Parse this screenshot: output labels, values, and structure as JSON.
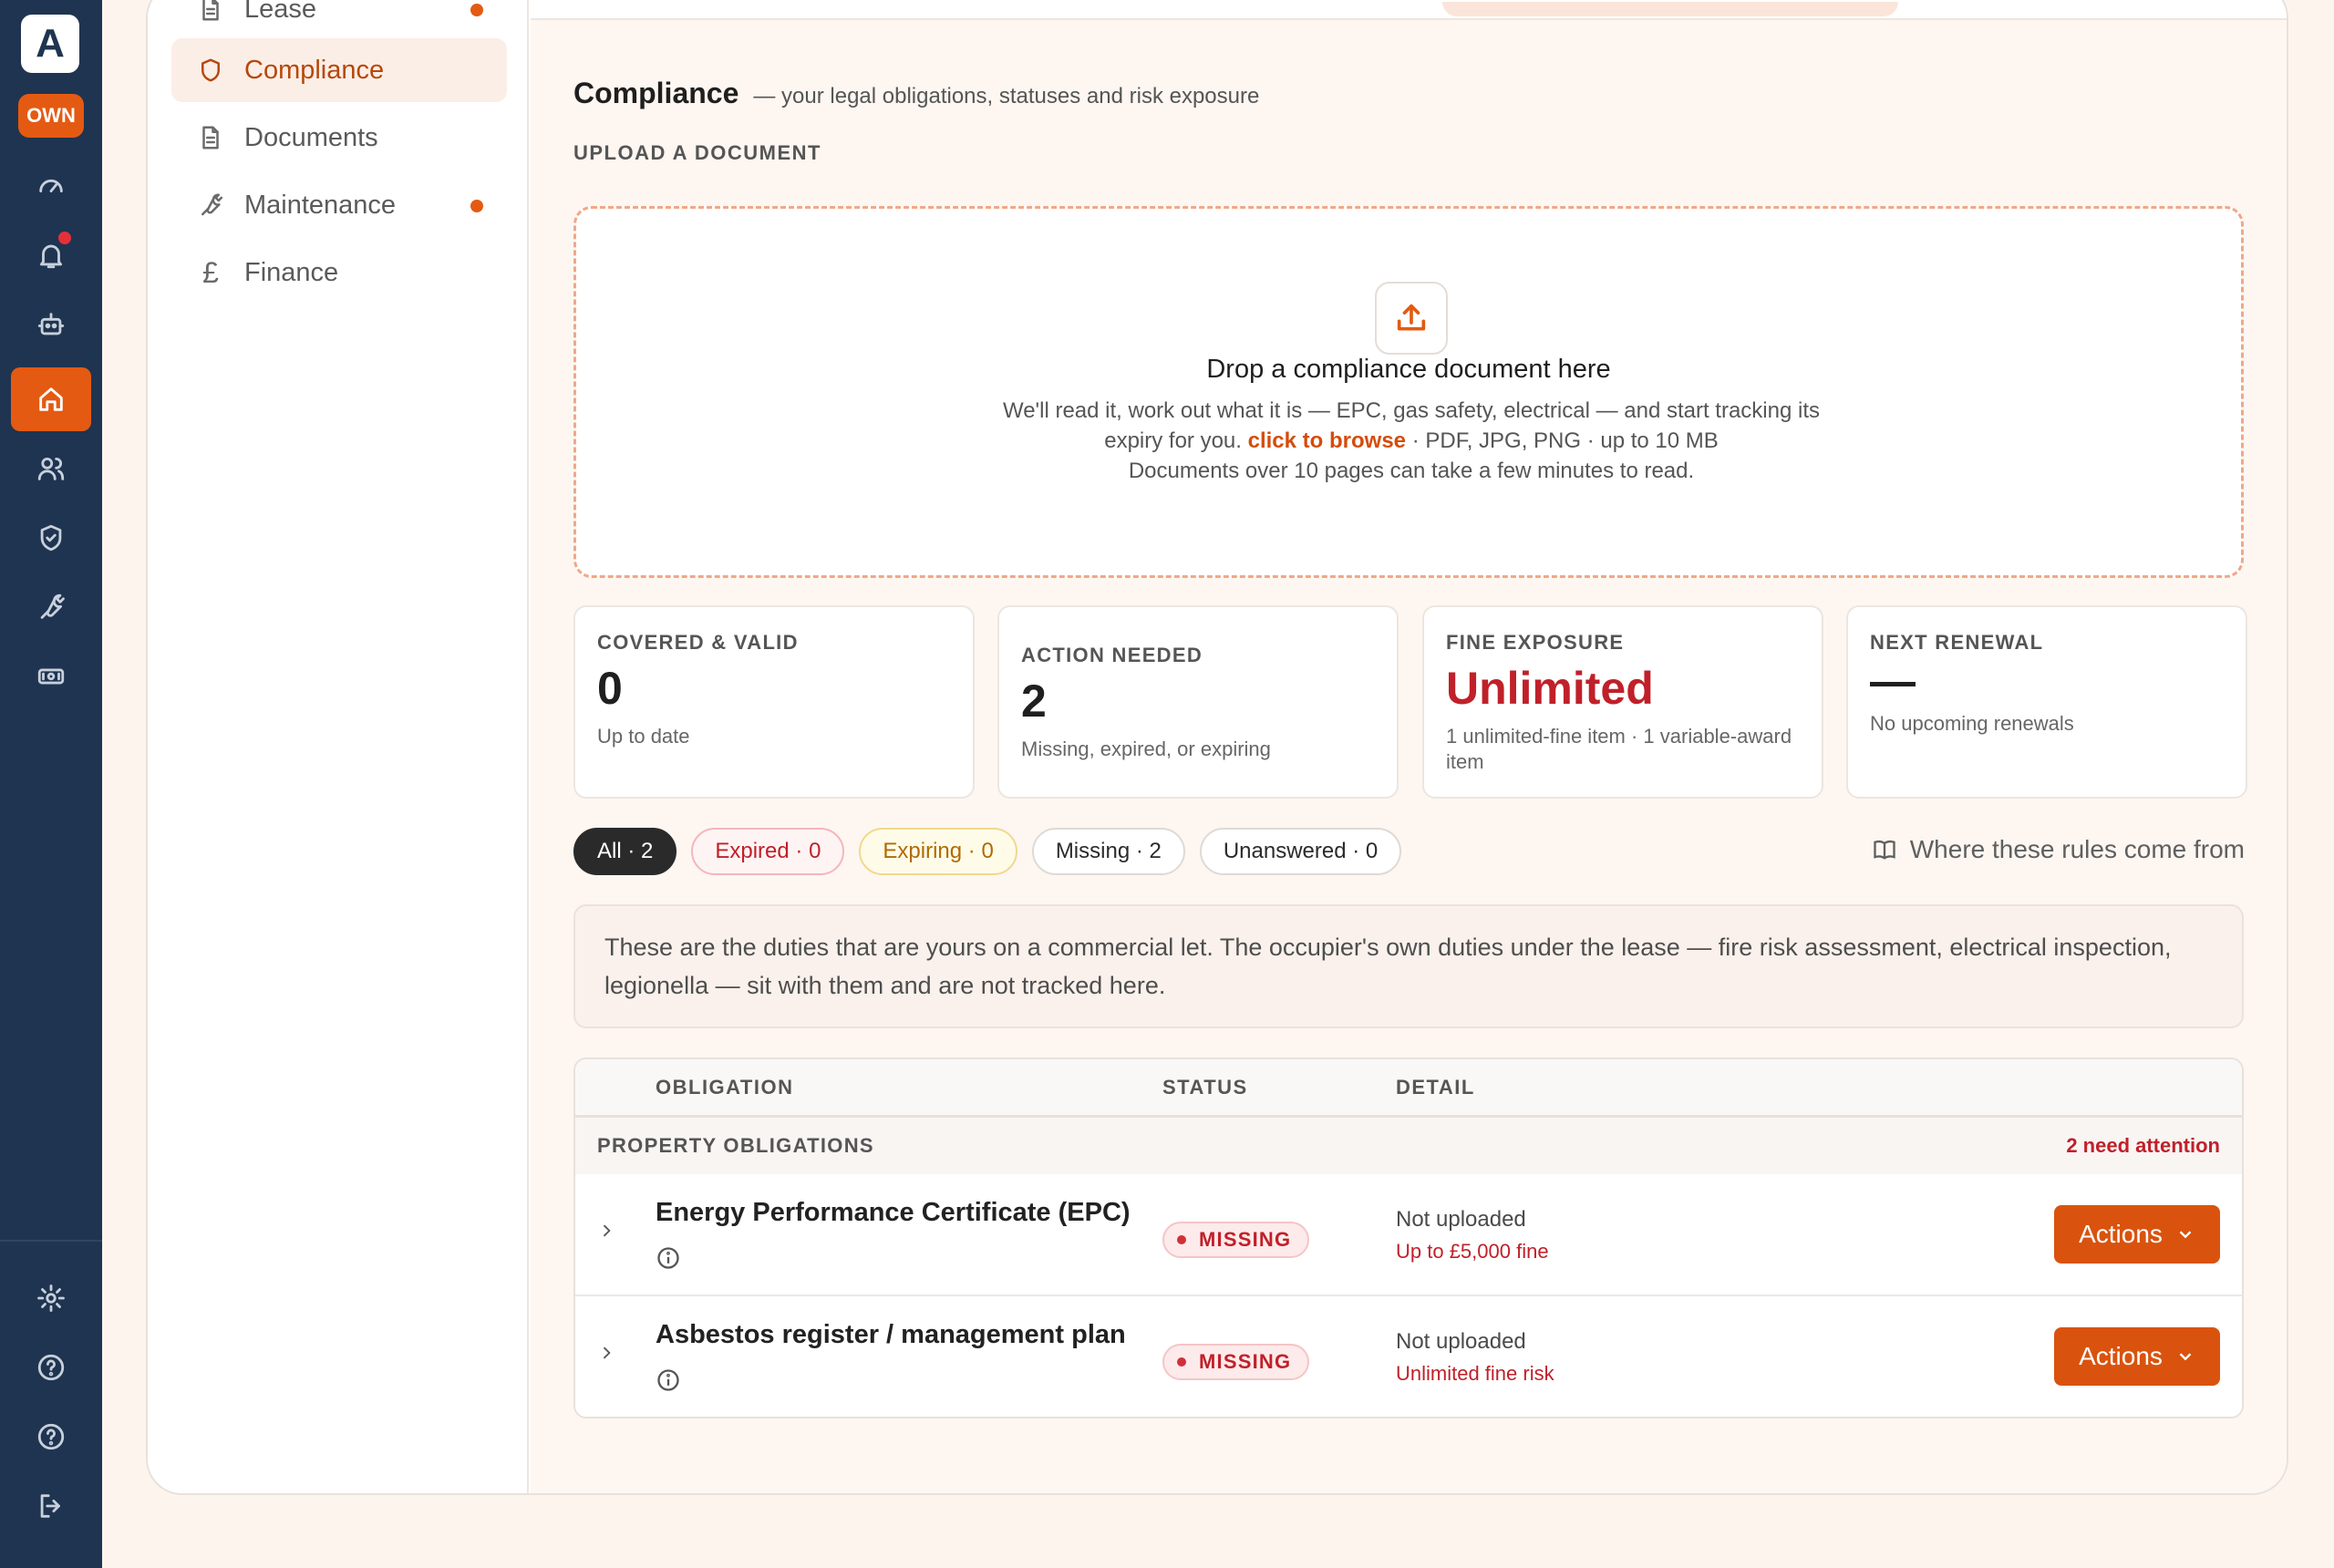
{
  "rail": {
    "logo_letter": "A",
    "role_badge": "OWN"
  },
  "subnav": {
    "items": [
      {
        "label": "Lease",
        "icon": "document-icon",
        "has_dot": true
      },
      {
        "label": "Compliance",
        "icon": "shield-icon",
        "active": true
      },
      {
        "label": "Documents",
        "icon": "document-icon"
      },
      {
        "label": "Maintenance",
        "icon": "wrench-icon",
        "has_dot": true
      },
      {
        "label": "Finance",
        "icon": "pound-icon",
        "glyph": "£"
      }
    ]
  },
  "header": {
    "title": "Compliance",
    "subtitle": "— your legal obligations, statuses and risk exposure"
  },
  "upload": {
    "section_label": "UPLOAD A DOCUMENT",
    "title": "Drop a compliance document here",
    "text_before_link": "We'll read it, work out what it is — EPC, gas safety, electrical — and start tracking its expiry for you.",
    "link": "click to browse",
    "text_after_link": "· PDF, JPG, PNG · up to 10 MB",
    "note": "Documents over 10 pages can take a few minutes to read."
  },
  "stats": [
    {
      "label": "COVERED & VALID",
      "value": "0",
      "sub": "Up to date"
    },
    {
      "label": "ACTION NEEDED",
      "value": "2",
      "sub": "Missing, expired, or expiring"
    },
    {
      "label": "FINE EXPOSURE",
      "value": "Unlimited",
      "sub": "1 unlimited-fine item · 1 variable-award item"
    },
    {
      "label": "NEXT RENEWAL",
      "value": "—",
      "sub": "No upcoming renewals"
    }
  ],
  "filters": [
    {
      "label": "All · 2"
    },
    {
      "label": "Expired · 0"
    },
    {
      "label": "Expiring · 0"
    },
    {
      "label": "Missing · 2"
    },
    {
      "label": "Unanswered · 0"
    }
  ],
  "rules_link": "Where these rules come from",
  "notice": "These are the duties that are yours on a commercial let. The occupier's own duties under the lease — fire risk assessment, electrical inspection, legionella — sit with them and are not tracked here.",
  "table": {
    "columns": [
      "OBLIGATION",
      "STATUS",
      "DETAIL"
    ],
    "group_label": "PROPERTY OBLIGATIONS",
    "group_attention": "2 need attention",
    "rows": [
      {
        "name": "Energy Performance Certificate (EPC)",
        "status": "MISSING",
        "detail": "Not uploaded",
        "risk": "Up to £5,000 fine",
        "action": "Actions"
      },
      {
        "name": "Asbestos register / management plan",
        "status": "MISSING",
        "detail": "Not uploaded",
        "risk": "Unlimited fine risk",
        "action": "Actions"
      }
    ]
  },
  "colors": {
    "accent": "#e45a12",
    "rail_bg": "#1f3450",
    "danger": "#c0202a"
  }
}
